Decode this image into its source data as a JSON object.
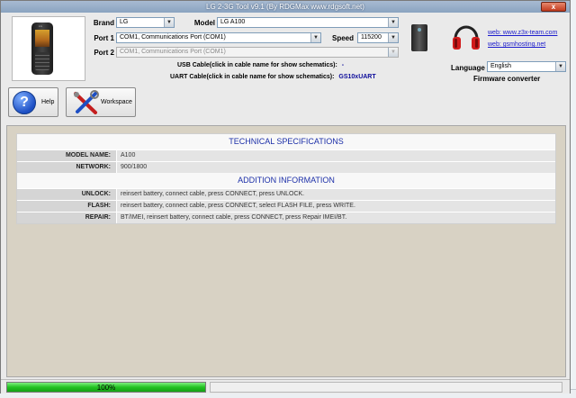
{
  "window": {
    "title": "LG 2-3G Tool v9.1 (By RDGMax www.rdgsoft.net)",
    "close_label": "x"
  },
  "phone": {
    "logo_text": "LG"
  },
  "form": {
    "brand_label": "Brand",
    "brand_value": "LG",
    "model_label": "Model",
    "model_value": "LG A100",
    "port1_label": "Port 1",
    "port1_value": "COM1, Communications Port (COM1)",
    "speed_label": "Speed",
    "speed_value": "115200",
    "port2_label": "Port 2",
    "port2_value": "COM1, Communications Port (COM1)",
    "usb_cable_label": "USB Cable(click in cable name for show schematics):",
    "usb_cable_value": "-",
    "uart_cable_label": "UART Cable(click in cable name for show schematics):",
    "uart_cable_value": "GS10xUART"
  },
  "links": {
    "web1": "web: www.z3x-team.com",
    "web2": "web: gsmhosting.net"
  },
  "language": {
    "label": "Language",
    "value": "English"
  },
  "firmware_converter_label": "Firmware converter",
  "toolbar": {
    "help_label": "Help",
    "help_icon": "?",
    "workspace_label": "Workspace"
  },
  "specs": {
    "technical_header": "TECHNICAL SPECIFICATIONS",
    "technical_rows": [
      {
        "key": "MODEL NAME:",
        "value": "A100"
      },
      {
        "key": "NETWORK:",
        "value": "900/1800"
      }
    ],
    "addition_header": "ADDITION INFORMATION",
    "addition_rows": [
      {
        "key": "UNLOCK:",
        "value": "reinsert battery, connect cable, press CONNECT, press UNLOCK."
      },
      {
        "key": "FLASH:",
        "value": "reinsert battery, connect cable, press CONNECT, select FLASH FILE, press WRITE."
      },
      {
        "key": "REPAIR:",
        "value": "BT/IMEI, reinsert battery, connect cable, press CONNECT, press Repair IMEI/BT."
      }
    ]
  },
  "status": {
    "progress": 1.0,
    "progress_text": "100%"
  },
  "colors": {
    "titlebar": "#8aa3c0",
    "panel": "#d8d2c4",
    "header_text": "#1c2fa8",
    "progress_green": "#22c222",
    "link_blue": "#1a1acc"
  }
}
